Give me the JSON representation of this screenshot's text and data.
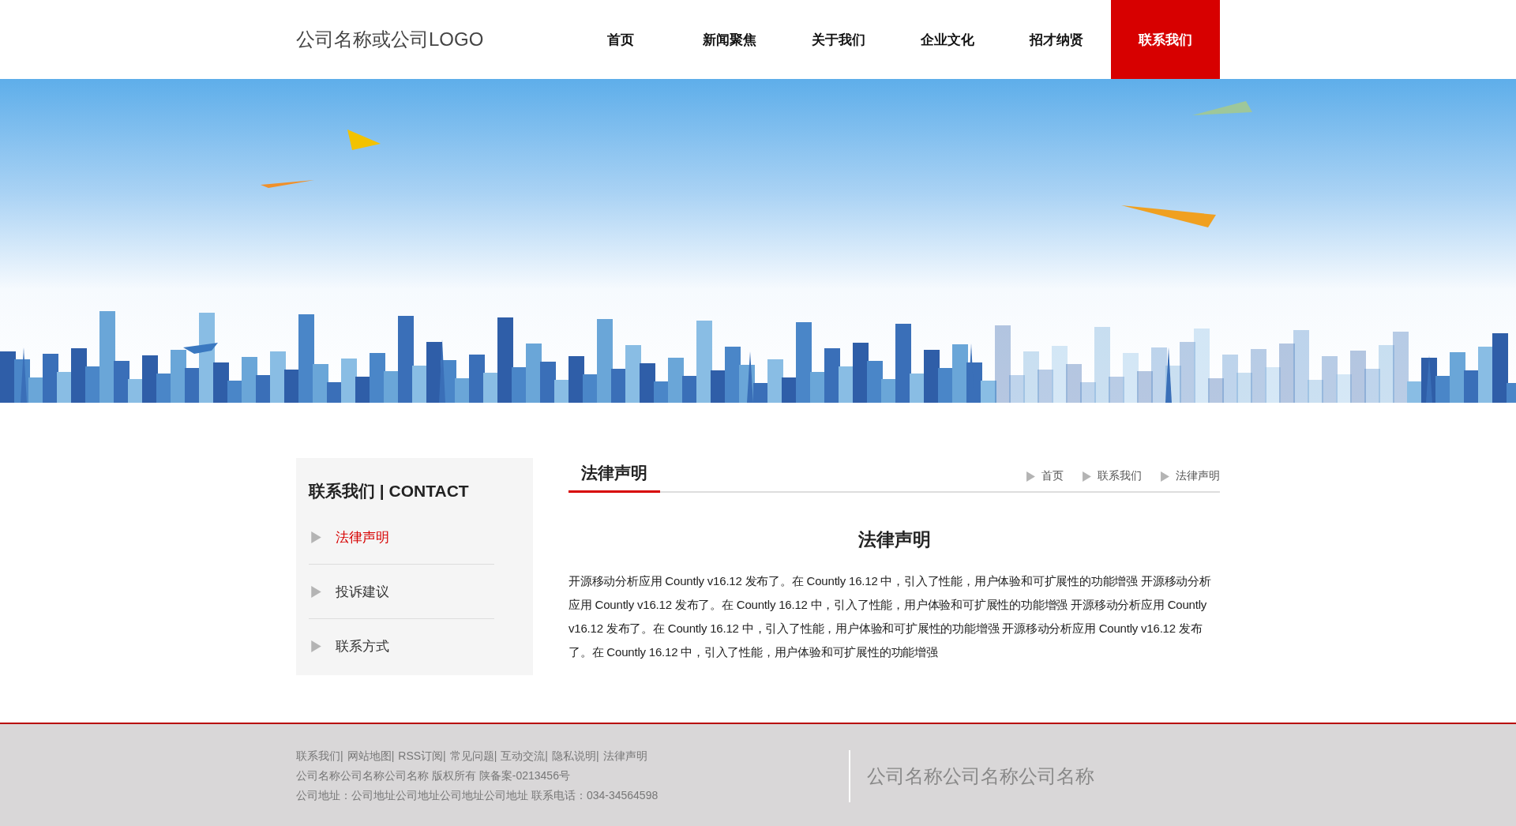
{
  "header": {
    "logo": "公司名称或公司LOGO",
    "nav": [
      {
        "label": "首页",
        "selected": false
      },
      {
        "label": "新闻聚焦",
        "selected": false
      },
      {
        "label": "关于我们",
        "selected": false
      },
      {
        "label": "企业文化",
        "selected": false
      },
      {
        "label": "招才纳贤",
        "selected": false
      },
      {
        "label": "联系我们",
        "selected": true
      }
    ]
  },
  "sidebar": {
    "title": "联系我们 | CONTACT",
    "items": [
      {
        "label": "法律声明",
        "selected": true
      },
      {
        "label": "投诉建议",
        "selected": false
      },
      {
        "label": "联系方式",
        "selected": false
      }
    ]
  },
  "main": {
    "tab": "法律声明",
    "breadcrumb": [
      "首页",
      "联系我们",
      "法律声明"
    ],
    "title": "法律声明",
    "body": "开源移动分析应用 Countly v16.12 发布了。在 Countly 16.12 中，引入了性能，用户体验和可扩展性的功能增强 开源移动分析应用 Countly v16.12 发布了。在 Countly 16.12 中，引入了性能，用户体验和可扩展性的功能增强 开源移动分析应用 Countly v16.12 发布了。在 Countly 16.12 中，引入了性能，用户体验和可扩展性的功能增强 开源移动分析应用 Countly v16.12 发布了。在 Countly 16.12 中，引入了性能，用户体验和可扩展性的功能增强"
  },
  "footer": {
    "links": [
      "联系我们",
      "网站地图",
      "RSS订阅",
      "常见问题",
      "互动交流",
      "隐私说明",
      "法律声明"
    ],
    "separator": "|",
    "copyright": "公司名称公司名称公司名称 版权所有 陕备案-0213456号",
    "address": "公司地址：公司地址公司地址公司地址公司地址 联系电话：034-34564598",
    "company": "公司名称公司名称公司名称"
  }
}
